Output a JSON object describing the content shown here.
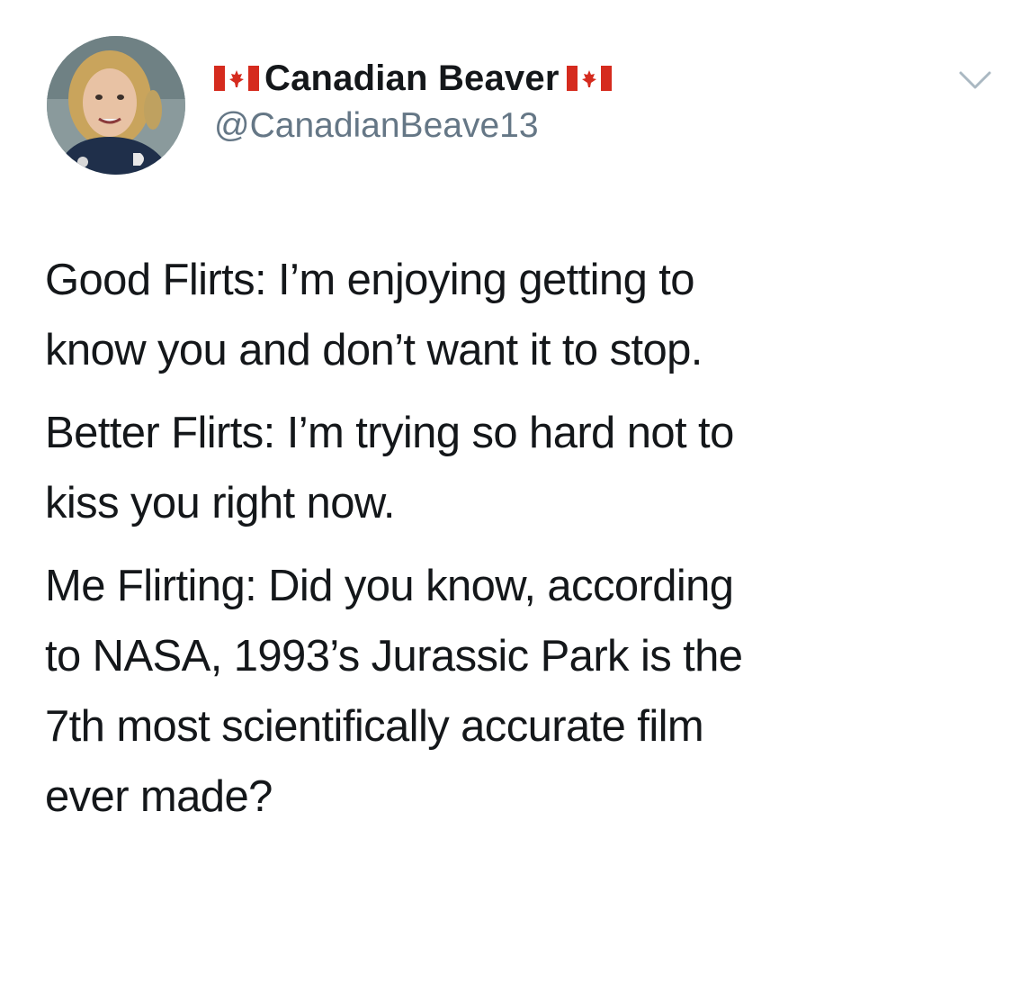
{
  "user": {
    "display_name": "Canadian Beaver",
    "handle": "@CanadianBeave13",
    "flag_icon": "canada-flag-icon",
    "flag_colors": {
      "red": "#d52b1e",
      "white": "#ffffff"
    }
  },
  "tweet": {
    "paragraphs": [
      {
        "lines": [
          "Good Flirts: I’m enjoying getting to",
          "know you and don’t want it to stop."
        ]
      },
      {
        "lines": [
          "Better Flirts: I’m trying so hard not to",
          "kiss you right now."
        ]
      },
      {
        "lines": [
          "Me Flirting: Did you know, according",
          "to NASA, 1993’s Jurassic Park is the",
          "7th most scientifically accurate film",
          "ever made?"
        ]
      }
    ]
  },
  "colors": {
    "text": "#14171a",
    "secondary_text": "#657786",
    "caret": "#aab8c2"
  }
}
